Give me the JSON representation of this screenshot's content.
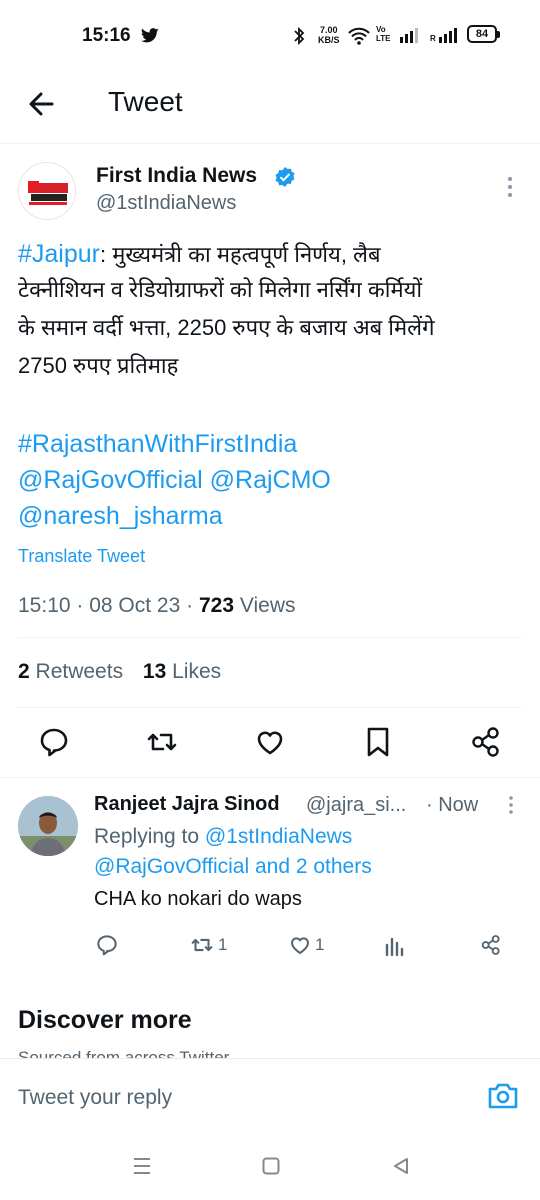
{
  "status_bar": {
    "time": "15:16",
    "net_speed_value": "7.00",
    "net_speed_unit": "KB/S",
    "volte_top": "Vo",
    "volte_bottom": "LTE",
    "roaming": "R",
    "battery": "84"
  },
  "header": {
    "title": "Tweet"
  },
  "tweet": {
    "display_name": "First India News",
    "username": "@1stIndiaNews",
    "hashtag_location": "#Jaipur",
    "text_line1": ": मुख्यमंत्री का महत्वपूर्ण निर्णय, लैब",
    "text_line2": "टेक्नीशियन व रेडियोग्राफरों को मिलेगा नर्सिंग कर्मियों",
    "text_line3": "के समान वर्दी भत्ता, 2250 रुपए के बजाय अब मिलेंगे",
    "text_line4": "2750 रुपए प्रतिमाह",
    "tag1": "#RajasthanWithFirstIndia",
    "mention1": "@RajGovOfficial",
    "mention2": "@RajCMO",
    "mention3": "@naresh_jsharma",
    "translate": "Translate Tweet",
    "time": "15:10",
    "date": "08 Oct 23",
    "views_count": "723",
    "views_label": "Views",
    "retweets_count": "2",
    "retweets_label": "Retweets",
    "likes_count": "13",
    "likes_label": "Likes"
  },
  "reply": {
    "name": "Ranjeet Jajra Sinod",
    "handle": "@jajra_si...",
    "time": "· Now",
    "replying_prefix": "Replying to ",
    "replying_to1": "@1stIndiaNews",
    "replying_line2": "@RajGovOfficial and 2 others",
    "text": "CHA ko nokari do waps",
    "retweet_count": "1",
    "like_count": "1"
  },
  "discover": {
    "title": "Discover more",
    "subtitle": "Sourced from across Twitter"
  },
  "reply_bar": {
    "placeholder": "Tweet your reply"
  },
  "colors": {
    "accent": "#1d9bf0",
    "text": "#0f1419",
    "muted": "#536471"
  }
}
